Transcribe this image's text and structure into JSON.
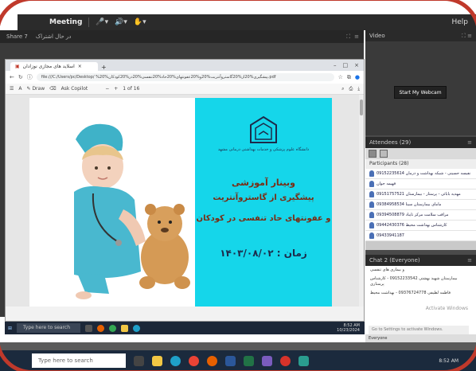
{
  "meeting_bar": {
    "title": "Meeting",
    "help": "Help"
  },
  "share_pod": {
    "title": "Share 7",
    "subtitle": "در حال اشتراک"
  },
  "browser": {
    "tab_title": "اسلاید های مجازی نوزادان",
    "address": "file:///C:/Users/pc/Desktop/ %پیشگیری%20از%20گاستروآنتریت%20و%20عفونتهای%20حاد%20تنفسی%20در%20کودکان%20.pdf",
    "draw_label": "Draw",
    "read_aloud": "Ask Copilot",
    "page_indicator": "1 of 16"
  },
  "slide": {
    "university": "دانشگاه علوم پزشکی و خدمات بهداشتی درمانی مشهد",
    "title": "وبینار آموزشی",
    "line1": "پیشگیری از گاستروآنتریت",
    "line2": "و عفونتهای حاد تنفسی در کودکان",
    "date_line": "زمان : ۱۴۰۳/۰۸/۰۲"
  },
  "inner_taskbar": {
    "search": "Type here to search",
    "time": "8:52 AM",
    "date": "10/23/2024"
  },
  "video_pod": {
    "title": "Video",
    "button": "Start My Webcam"
  },
  "attendees_pod": {
    "title": "Attendees (29)",
    "participants_header": "Participants (28)",
    "rows": [
      "نفیسه حسینی - شبکه بهداشت و درمان 09152235614",
      "فهیمه جوان",
      "مهدیه بابائی - پرستار - بیمارستان 09151757521",
      "مامای بیمارستان سینا 09384958534",
      "مراقب سلامت مرکز تایباد 09394508879",
      "کارشناس بهداشت محیط 09442430376",
      "09433941187"
    ]
  },
  "chat_pod": {
    "title": "Chat 2 (Everyone)",
    "messages": [
      "و بیماری های تنفسی",
      "بیمارستان شهید بهشتی 09152233542 - کارشناس پرستاری",
      "فاطمه لطیفی 09376724778 - بهداشت محیط"
    ],
    "input_placeholder": "Go to Settings to activate Windows.",
    "watermark": "Activate Windows",
    "scope": "Everyone"
  },
  "outer_taskbar": {
    "search": "Type here to search",
    "time": "8:52 AM"
  },
  "colors": {
    "border": "#c0392b",
    "slide_bg": "#15d6ea",
    "title_color": "#7b2b12"
  }
}
